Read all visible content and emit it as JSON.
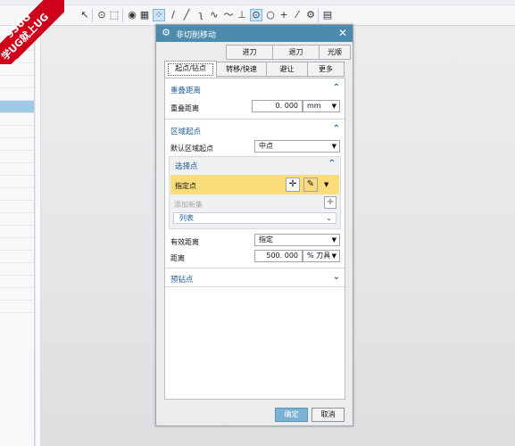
{
  "watermark": {
    "line1": "9SUG",
    "line2": "学UG就上UG网"
  },
  "toolbar": {
    "icons": [
      "layer-icon",
      "snap-icon",
      "circle-icon",
      "rect-select-icon",
      "view-icon",
      "cube-icon",
      "grid-icon",
      "line-icon",
      "line2-icon",
      "curve-icon",
      "spline-icon",
      "wave-icon",
      "perpendicular-icon",
      "center-icon",
      "circle2-icon",
      "plus-icon",
      "slash-icon",
      "gear2-icon",
      "copy-icon"
    ]
  },
  "dialog": {
    "title": "非切削移动",
    "close": "✕",
    "tabs_row1": [
      "进刀",
      "退刀",
      "光顺"
    ],
    "tabs_row2": [
      "起点/钻点",
      "转移/快速",
      "避让",
      "更多"
    ],
    "overlap": {
      "title": "重叠距离",
      "label": "重叠距离",
      "value": "0. 000",
      "unit": "mm"
    },
    "region": {
      "title": "区域起点",
      "default_label": "默认区域起点",
      "default_value": "中点",
      "select_point": {
        "title": "选择点",
        "spec_label": "指定点",
        "add_new": "添加新集",
        "list_label": "列表"
      },
      "effective_label": "有效距离",
      "effective_value": "指定",
      "distance_label": "距离",
      "distance_value": "500. 000",
      "distance_unit": "% 刀具"
    },
    "predrill": {
      "title": "预钻点"
    },
    "ok": "确定",
    "cancel": "取消"
  }
}
